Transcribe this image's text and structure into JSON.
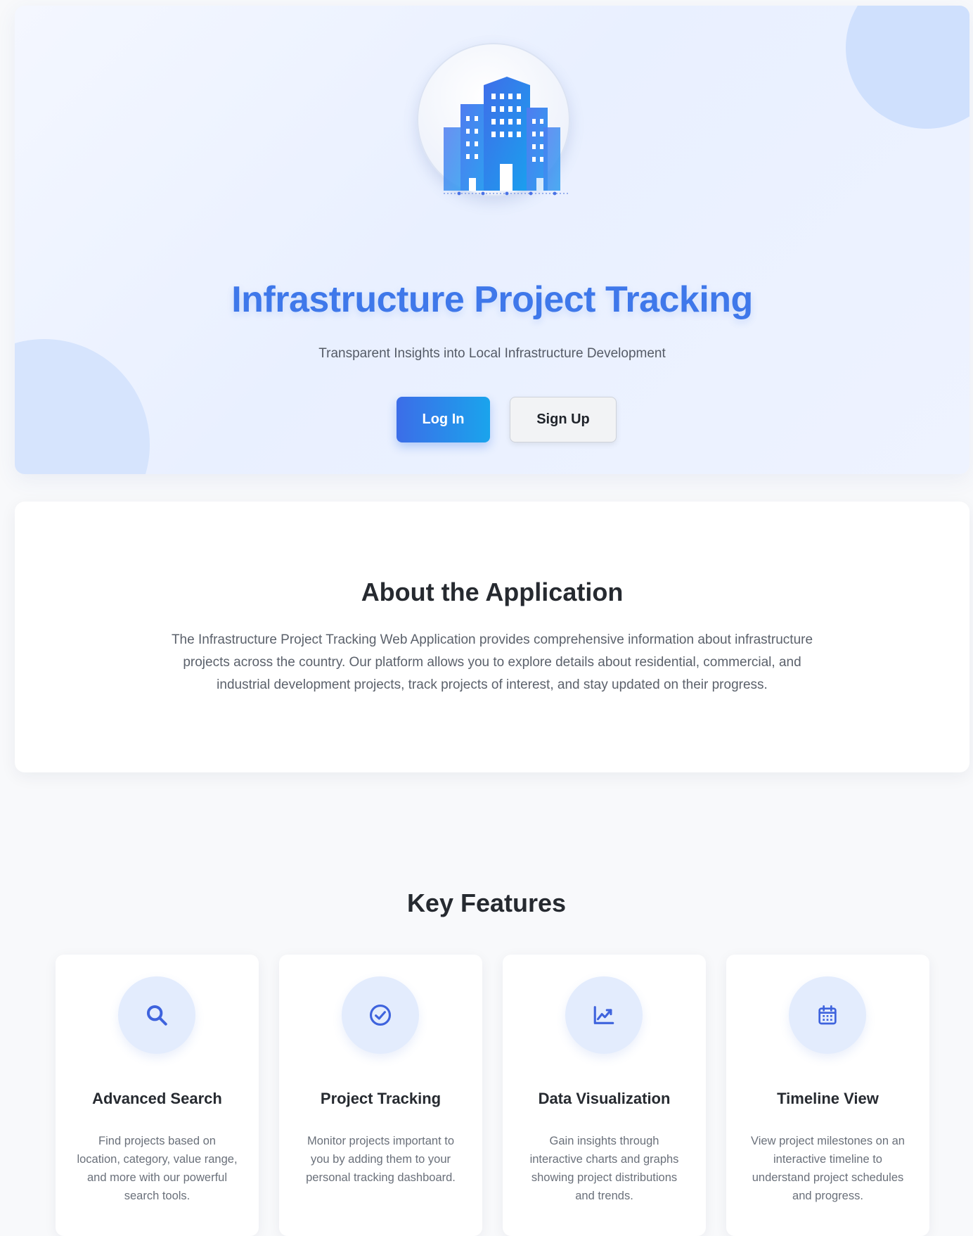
{
  "hero": {
    "title": "Infrastructure Project Tracking",
    "subtitle": "Transparent Insights into Local Infrastructure Development",
    "login_label": "Log In",
    "signup_label": "Sign Up",
    "accent_color": "#3f78ea",
    "logo_icon": "city-buildings-icon"
  },
  "about": {
    "title": "About the Application",
    "text": "The Infrastructure Project Tracking Web Application provides comprehensive information about infrastructure projects across the country. Our platform allows you to explore details about residential, commercial, and industrial development projects, track projects of interest, and stay updated on their progress."
  },
  "features": {
    "title": "Key Features",
    "items": [
      {
        "icon": "search-icon",
        "title": "Advanced Search",
        "text": "Find projects based on location, category, value range, and more with our powerful search tools."
      },
      {
        "icon": "check-circle-icon",
        "title": "Project Tracking",
        "text": "Monitor projects important to you by adding them to your personal tracking dashboard."
      },
      {
        "icon": "chart-line-icon",
        "title": "Data Visualization",
        "text": "Gain insights through interactive charts and graphs showing project distributions and trends."
      },
      {
        "icon": "calendar-icon",
        "title": "Timeline View",
        "text": "View project milestones on an interactive timeline to understand project schedules and progress."
      }
    ]
  }
}
